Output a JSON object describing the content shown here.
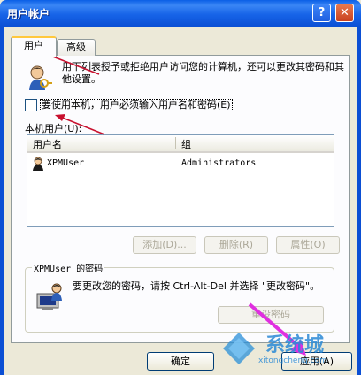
{
  "window": {
    "title": "用户帐户",
    "help_glyph": "?",
    "close_glyph": "✕"
  },
  "tabs": [
    {
      "label": "用户",
      "active": true
    },
    {
      "label": "高级",
      "active": false
    }
  ],
  "intro_text": "用下列表授予或拒绝用户访问您的计算机，还可以更改其密码和其他设置。",
  "require_login_checkbox": {
    "label": "要使用本机，用户必须输入用户名和密码(E)",
    "checked": false
  },
  "users_section_label": "本机用户(U):",
  "users_table": {
    "columns": [
      "用户名",
      "组"
    ],
    "rows": [
      {
        "user": "XPMUser",
        "group": "Administrators"
      }
    ]
  },
  "list_buttons": {
    "add": "添加(D)...",
    "remove": "删除(R)",
    "properties": "属性(O)"
  },
  "password_group": {
    "title": "XPMUser 的密码",
    "text": "要更改您的密码，请按 Ctrl-Alt-Del 并选择 \"更改密码\"。",
    "reset_button": "重设密码"
  },
  "dialog_buttons": {
    "ok": "确定",
    "apply": "应用(A)"
  },
  "watermark": {
    "text": "系统城",
    "url": "xitongcheng.com"
  },
  "colors": {
    "titlebar": "#0b4fd4",
    "annotation_red": "#c8102e",
    "annotation_magenta": "#e02fe0"
  }
}
